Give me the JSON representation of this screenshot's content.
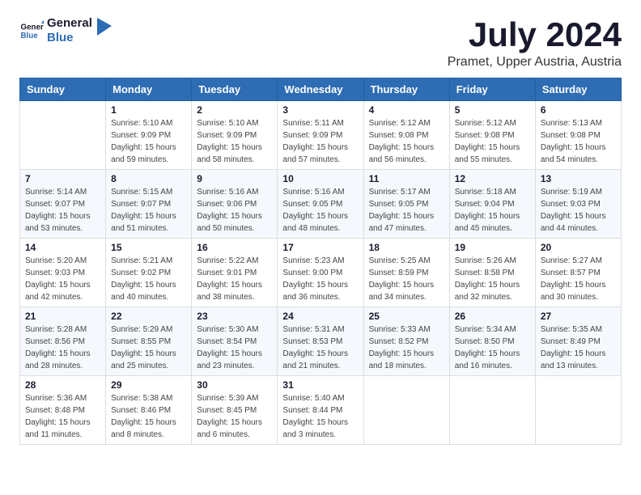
{
  "header": {
    "logo_line1": "General",
    "logo_line2": "Blue",
    "month_title": "July 2024",
    "location": "Pramet, Upper Austria, Austria"
  },
  "days_of_week": [
    "Sunday",
    "Monday",
    "Tuesday",
    "Wednesday",
    "Thursday",
    "Friday",
    "Saturday"
  ],
  "weeks": [
    [
      {
        "day": "",
        "sunrise": "",
        "sunset": "",
        "daylight": ""
      },
      {
        "day": "1",
        "sunrise": "Sunrise: 5:10 AM",
        "sunset": "Sunset: 9:09 PM",
        "daylight": "Daylight: 15 hours and 59 minutes."
      },
      {
        "day": "2",
        "sunrise": "Sunrise: 5:10 AM",
        "sunset": "Sunset: 9:09 PM",
        "daylight": "Daylight: 15 hours and 58 minutes."
      },
      {
        "day": "3",
        "sunrise": "Sunrise: 5:11 AM",
        "sunset": "Sunset: 9:09 PM",
        "daylight": "Daylight: 15 hours and 57 minutes."
      },
      {
        "day": "4",
        "sunrise": "Sunrise: 5:12 AM",
        "sunset": "Sunset: 9:08 PM",
        "daylight": "Daylight: 15 hours and 56 minutes."
      },
      {
        "day": "5",
        "sunrise": "Sunrise: 5:12 AM",
        "sunset": "Sunset: 9:08 PM",
        "daylight": "Daylight: 15 hours and 55 minutes."
      },
      {
        "day": "6",
        "sunrise": "Sunrise: 5:13 AM",
        "sunset": "Sunset: 9:08 PM",
        "daylight": "Daylight: 15 hours and 54 minutes."
      }
    ],
    [
      {
        "day": "7",
        "sunrise": "Sunrise: 5:14 AM",
        "sunset": "Sunset: 9:07 PM",
        "daylight": "Daylight: 15 hours and 53 minutes."
      },
      {
        "day": "8",
        "sunrise": "Sunrise: 5:15 AM",
        "sunset": "Sunset: 9:07 PM",
        "daylight": "Daylight: 15 hours and 51 minutes."
      },
      {
        "day": "9",
        "sunrise": "Sunrise: 5:16 AM",
        "sunset": "Sunset: 9:06 PM",
        "daylight": "Daylight: 15 hours and 50 minutes."
      },
      {
        "day": "10",
        "sunrise": "Sunrise: 5:16 AM",
        "sunset": "Sunset: 9:05 PM",
        "daylight": "Daylight: 15 hours and 48 minutes."
      },
      {
        "day": "11",
        "sunrise": "Sunrise: 5:17 AM",
        "sunset": "Sunset: 9:05 PM",
        "daylight": "Daylight: 15 hours and 47 minutes."
      },
      {
        "day": "12",
        "sunrise": "Sunrise: 5:18 AM",
        "sunset": "Sunset: 9:04 PM",
        "daylight": "Daylight: 15 hours and 45 minutes."
      },
      {
        "day": "13",
        "sunrise": "Sunrise: 5:19 AM",
        "sunset": "Sunset: 9:03 PM",
        "daylight": "Daylight: 15 hours and 44 minutes."
      }
    ],
    [
      {
        "day": "14",
        "sunrise": "Sunrise: 5:20 AM",
        "sunset": "Sunset: 9:03 PM",
        "daylight": "Daylight: 15 hours and 42 minutes."
      },
      {
        "day": "15",
        "sunrise": "Sunrise: 5:21 AM",
        "sunset": "Sunset: 9:02 PM",
        "daylight": "Daylight: 15 hours and 40 minutes."
      },
      {
        "day": "16",
        "sunrise": "Sunrise: 5:22 AM",
        "sunset": "Sunset: 9:01 PM",
        "daylight": "Daylight: 15 hours and 38 minutes."
      },
      {
        "day": "17",
        "sunrise": "Sunrise: 5:23 AM",
        "sunset": "Sunset: 9:00 PM",
        "daylight": "Daylight: 15 hours and 36 minutes."
      },
      {
        "day": "18",
        "sunrise": "Sunrise: 5:25 AM",
        "sunset": "Sunset: 8:59 PM",
        "daylight": "Daylight: 15 hours and 34 minutes."
      },
      {
        "day": "19",
        "sunrise": "Sunrise: 5:26 AM",
        "sunset": "Sunset: 8:58 PM",
        "daylight": "Daylight: 15 hours and 32 minutes."
      },
      {
        "day": "20",
        "sunrise": "Sunrise: 5:27 AM",
        "sunset": "Sunset: 8:57 PM",
        "daylight": "Daylight: 15 hours and 30 minutes."
      }
    ],
    [
      {
        "day": "21",
        "sunrise": "Sunrise: 5:28 AM",
        "sunset": "Sunset: 8:56 PM",
        "daylight": "Daylight: 15 hours and 28 minutes."
      },
      {
        "day": "22",
        "sunrise": "Sunrise: 5:29 AM",
        "sunset": "Sunset: 8:55 PM",
        "daylight": "Daylight: 15 hours and 25 minutes."
      },
      {
        "day": "23",
        "sunrise": "Sunrise: 5:30 AM",
        "sunset": "Sunset: 8:54 PM",
        "daylight": "Daylight: 15 hours and 23 minutes."
      },
      {
        "day": "24",
        "sunrise": "Sunrise: 5:31 AM",
        "sunset": "Sunset: 8:53 PM",
        "daylight": "Daylight: 15 hours and 21 minutes."
      },
      {
        "day": "25",
        "sunrise": "Sunrise: 5:33 AM",
        "sunset": "Sunset: 8:52 PM",
        "daylight": "Daylight: 15 hours and 18 minutes."
      },
      {
        "day": "26",
        "sunrise": "Sunrise: 5:34 AM",
        "sunset": "Sunset: 8:50 PM",
        "daylight": "Daylight: 15 hours and 16 minutes."
      },
      {
        "day": "27",
        "sunrise": "Sunrise: 5:35 AM",
        "sunset": "Sunset: 8:49 PM",
        "daylight": "Daylight: 15 hours and 13 minutes."
      }
    ],
    [
      {
        "day": "28",
        "sunrise": "Sunrise: 5:36 AM",
        "sunset": "Sunset: 8:48 PM",
        "daylight": "Daylight: 15 hours and 11 minutes."
      },
      {
        "day": "29",
        "sunrise": "Sunrise: 5:38 AM",
        "sunset": "Sunset: 8:46 PM",
        "daylight": "Daylight: 15 hours and 8 minutes."
      },
      {
        "day": "30",
        "sunrise": "Sunrise: 5:39 AM",
        "sunset": "Sunset: 8:45 PM",
        "daylight": "Daylight: 15 hours and 6 minutes."
      },
      {
        "day": "31",
        "sunrise": "Sunrise: 5:40 AM",
        "sunset": "Sunset: 8:44 PM",
        "daylight": "Daylight: 15 hours and 3 minutes."
      },
      {
        "day": "",
        "sunrise": "",
        "sunset": "",
        "daylight": ""
      },
      {
        "day": "",
        "sunrise": "",
        "sunset": "",
        "daylight": ""
      },
      {
        "day": "",
        "sunrise": "",
        "sunset": "",
        "daylight": ""
      }
    ]
  ]
}
